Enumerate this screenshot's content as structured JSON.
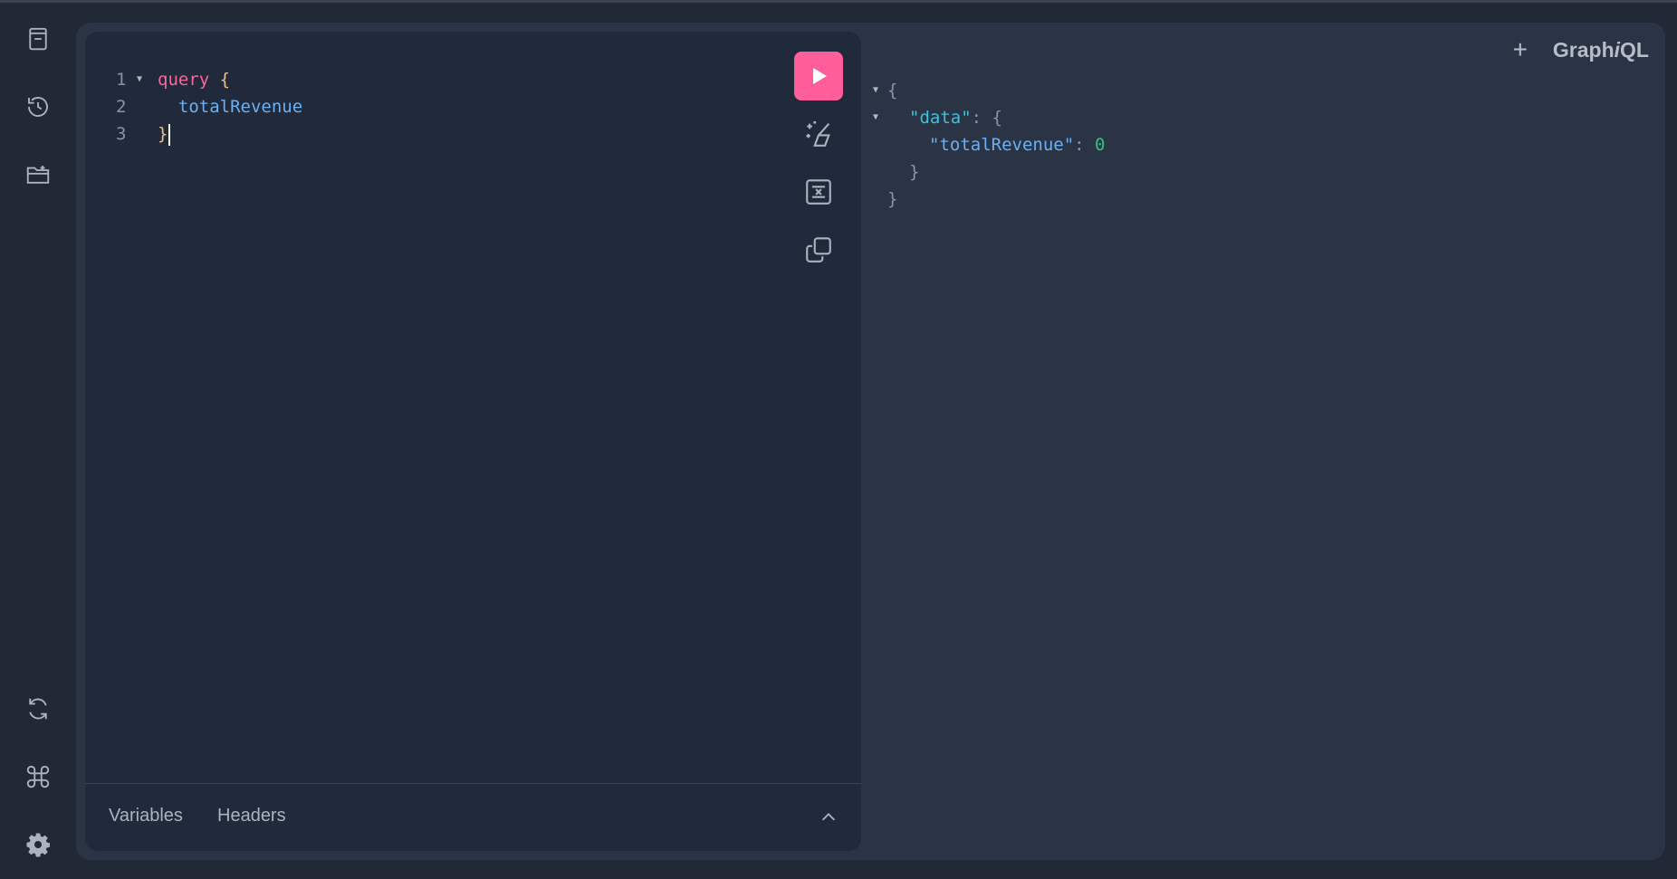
{
  "sidebar": {
    "top_icons": [
      "docs-icon",
      "history-icon",
      "folder-add-icon"
    ],
    "bottom_icons": [
      "refresh-icon",
      "command-icon",
      "gear-icon"
    ]
  },
  "editor": {
    "lines": [
      {
        "number": "1",
        "keyword": "query",
        "brace": "{"
      },
      {
        "number": "2",
        "field": "totalRevenue"
      },
      {
        "number": "3",
        "brace": "}"
      }
    ],
    "toolbar": [
      "run-icon",
      "prettify-icon",
      "merge-fragments-icon",
      "copy-icon"
    ],
    "bottom_tabs": [
      "Variables",
      "Headers"
    ]
  },
  "result": {
    "open_brace": "{",
    "data_key": "\"data\"",
    "colon": ": ",
    "data_open": "{",
    "field_key": "\"totalRevenue\"",
    "field_value": "0",
    "inner_close": "}",
    "outer_close": "}"
  },
  "header": {
    "plus": "+",
    "logo_prefix": "Graph",
    "logo_italic": "i",
    "logo_suffix": "QL"
  },
  "colors": {
    "accent": "#ff5e9a",
    "background": "#222936",
    "panel": "#2b3444",
    "editor": "#212a3a"
  }
}
